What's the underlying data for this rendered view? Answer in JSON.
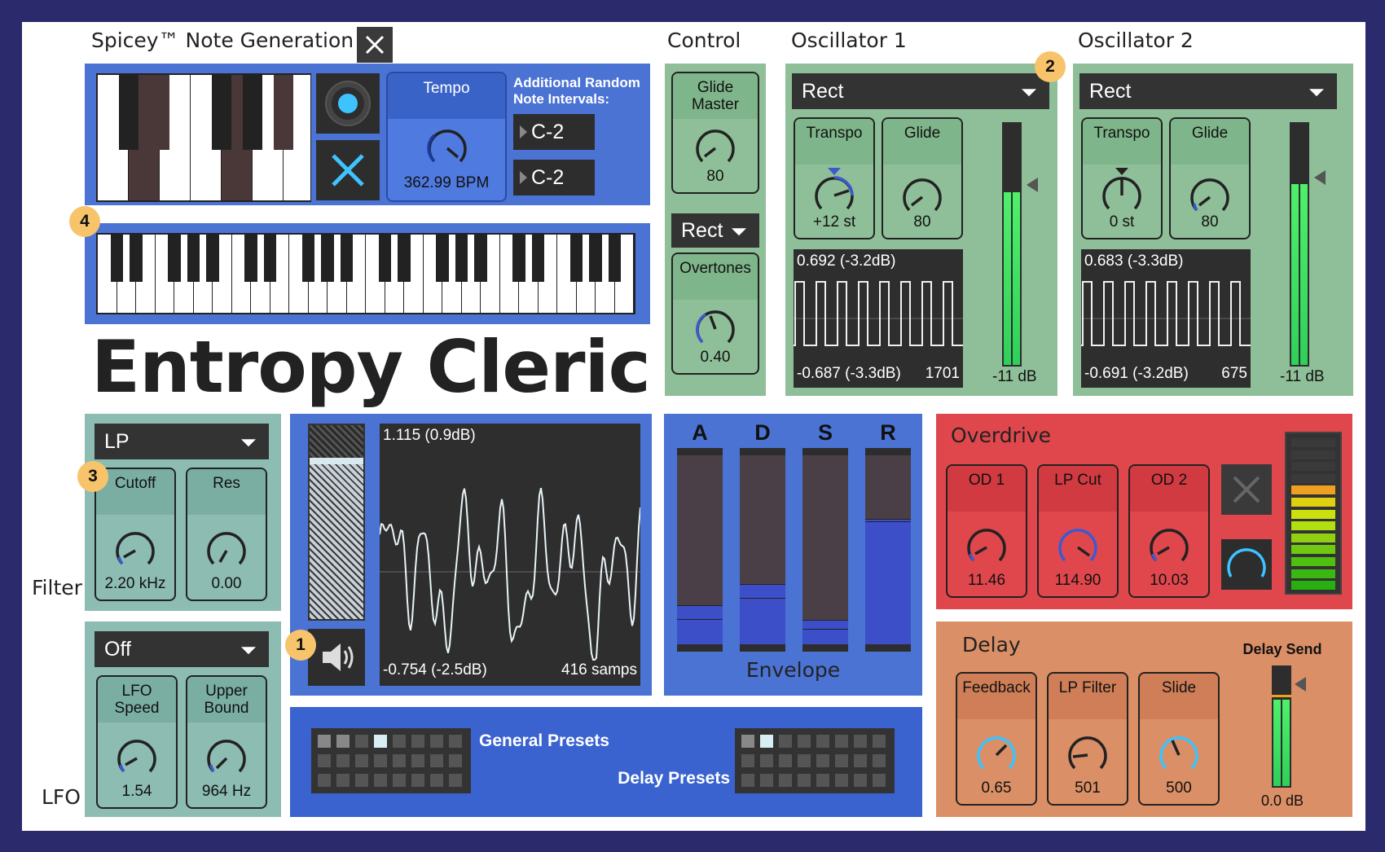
{
  "note_gen": {
    "title": "Spicey™ Note Generation",
    "tempo_label": "Tempo",
    "tempo_value": "362.99 BPM",
    "intervals_label": "Additional Random Note Intervals:",
    "interval_1": "C-2",
    "interval_2": "C-2",
    "app_title": "Entropy Cleric"
  },
  "control": {
    "title": "Control",
    "glide_master_label": "Glide Master",
    "glide_master_value": "80",
    "wave_select": "Rect",
    "overtones_label": "Overtones",
    "overtones_value": "0.40"
  },
  "osc1": {
    "title": "Oscillator 1",
    "wave_select": "Rect",
    "transpo_label": "Transpo",
    "transpo_value": "+12 st",
    "glide_label": "Glide",
    "glide_value": "80",
    "scope_top": "0.692 (-3.2dB)",
    "scope_bottom": "-0.687 (-3.3dB)",
    "scope_samples": "1701",
    "meter_value": "-11 dB"
  },
  "osc2": {
    "title": "Oscillator 2",
    "wave_select": "Rect",
    "transpo_label": "Transpo",
    "transpo_value": "0 st",
    "glide_label": "Glide",
    "glide_value": "80",
    "scope_top": "0.683 (-3.3dB)",
    "scope_bottom": "-0.691 (-3.2dB)",
    "scope_samples": "675",
    "meter_value": "-11 dB"
  },
  "filter": {
    "title": "Filter",
    "type_select": "LP",
    "cutoff_label": "Cutoff",
    "cutoff_value": "2.20 kHz",
    "res_label": "Res",
    "res_value": "0.00"
  },
  "lfo": {
    "title": "LFO",
    "target_select": "Off",
    "speed_label": "LFO Speed",
    "speed_value": "1.54",
    "upper_label": "Upper Bound",
    "upper_value": "964 Hz"
  },
  "output_scope": {
    "top": "1.115 (0.9dB)",
    "bottom": "-0.754 (-2.5dB)",
    "samples": "416 samps"
  },
  "envelope": {
    "title": "Envelope",
    "labels": [
      "A",
      "D",
      "S",
      "R"
    ]
  },
  "overdrive": {
    "title": "Overdrive",
    "od1_label": "OD 1",
    "od1_value": "11.46",
    "lpcut_label": "LP Cut",
    "lpcut_value": "114.90",
    "od2_label": "OD 2",
    "od2_value": "10.03"
  },
  "delay": {
    "title": "Delay",
    "feedback_label": "Feedback",
    "feedback_value": "0.65",
    "lpfilter_label": "LP Filter",
    "lpfilter_value": "501",
    "slide_label": "Slide",
    "slide_value": "500",
    "send_label": "Delay Send",
    "send_value": "0.0 dB"
  },
  "presets": {
    "general_label": "General Presets",
    "delay_label": "Delay Presets"
  },
  "badges": [
    "1",
    "2",
    "3",
    "4"
  ],
  "colors": {
    "blue_panel": "#4a73d4",
    "green_panel": "#8fbf98",
    "teal_panel": "#8cbcb2",
    "red_panel": "#e0474c",
    "orange_panel": "#db8f66",
    "accent": "#3ec3ff"
  }
}
